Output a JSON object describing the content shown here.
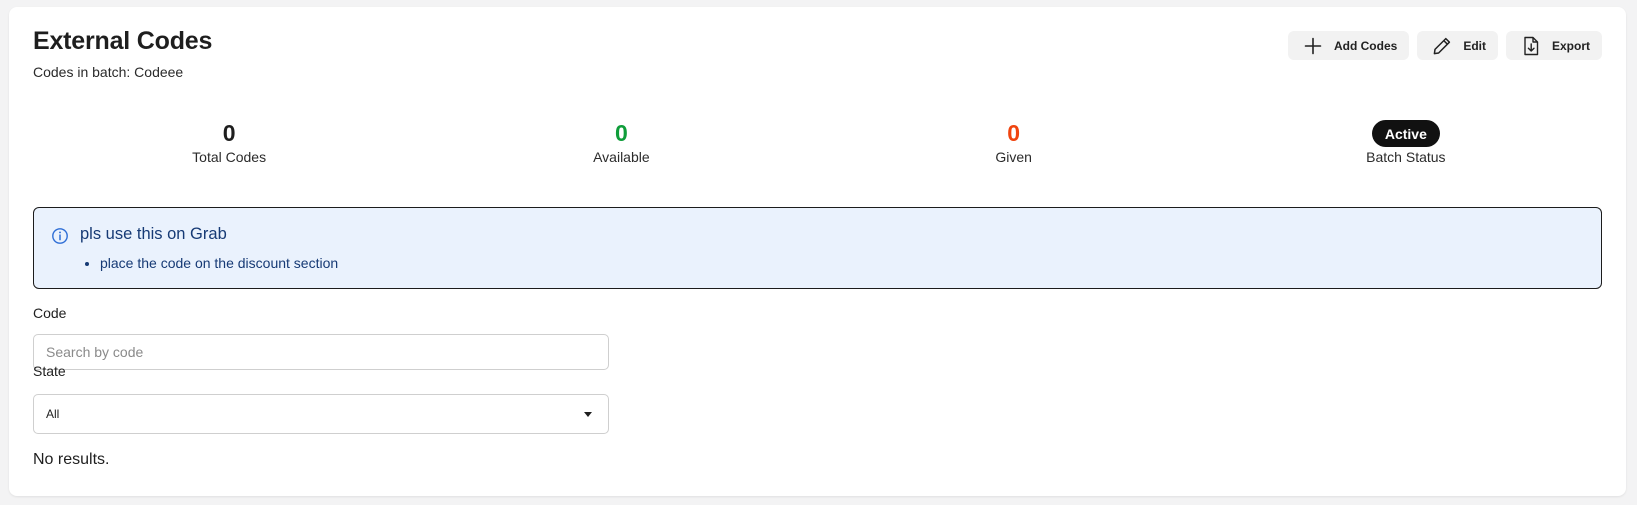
{
  "header": {
    "title": "External Codes",
    "subtitle": "Codes in batch: Codeee"
  },
  "toolbar": {
    "add_codes_label": "Add Codes",
    "edit_label": "Edit",
    "export_label": "Export"
  },
  "icons": {
    "add": "plus-icon",
    "edit": "pencil-icon",
    "export": "file-download-icon",
    "info": "info-circle-icon",
    "dropdown": "caret-down-icon"
  },
  "stats": {
    "total": {
      "value": "0",
      "label": "Total Codes",
      "color": "#1e1e1e"
    },
    "available": {
      "value": "0",
      "label": "Available",
      "color": "#0f9d3a"
    },
    "given": {
      "value": "0",
      "label": "Given",
      "color": "#f0440f"
    },
    "batch_status": {
      "value": "Active",
      "label": "Batch Status"
    }
  },
  "alert": {
    "title": "pls use this on Grab",
    "items": [
      "place the code on the discount section"
    ],
    "background": "#eaf2fd",
    "text_color": "#163a75"
  },
  "filters": {
    "code": {
      "label": "Code",
      "value": "",
      "placeholder": "Search by code"
    },
    "state": {
      "label": "State",
      "selected": "All"
    }
  },
  "results": {
    "empty_text": "No results."
  }
}
